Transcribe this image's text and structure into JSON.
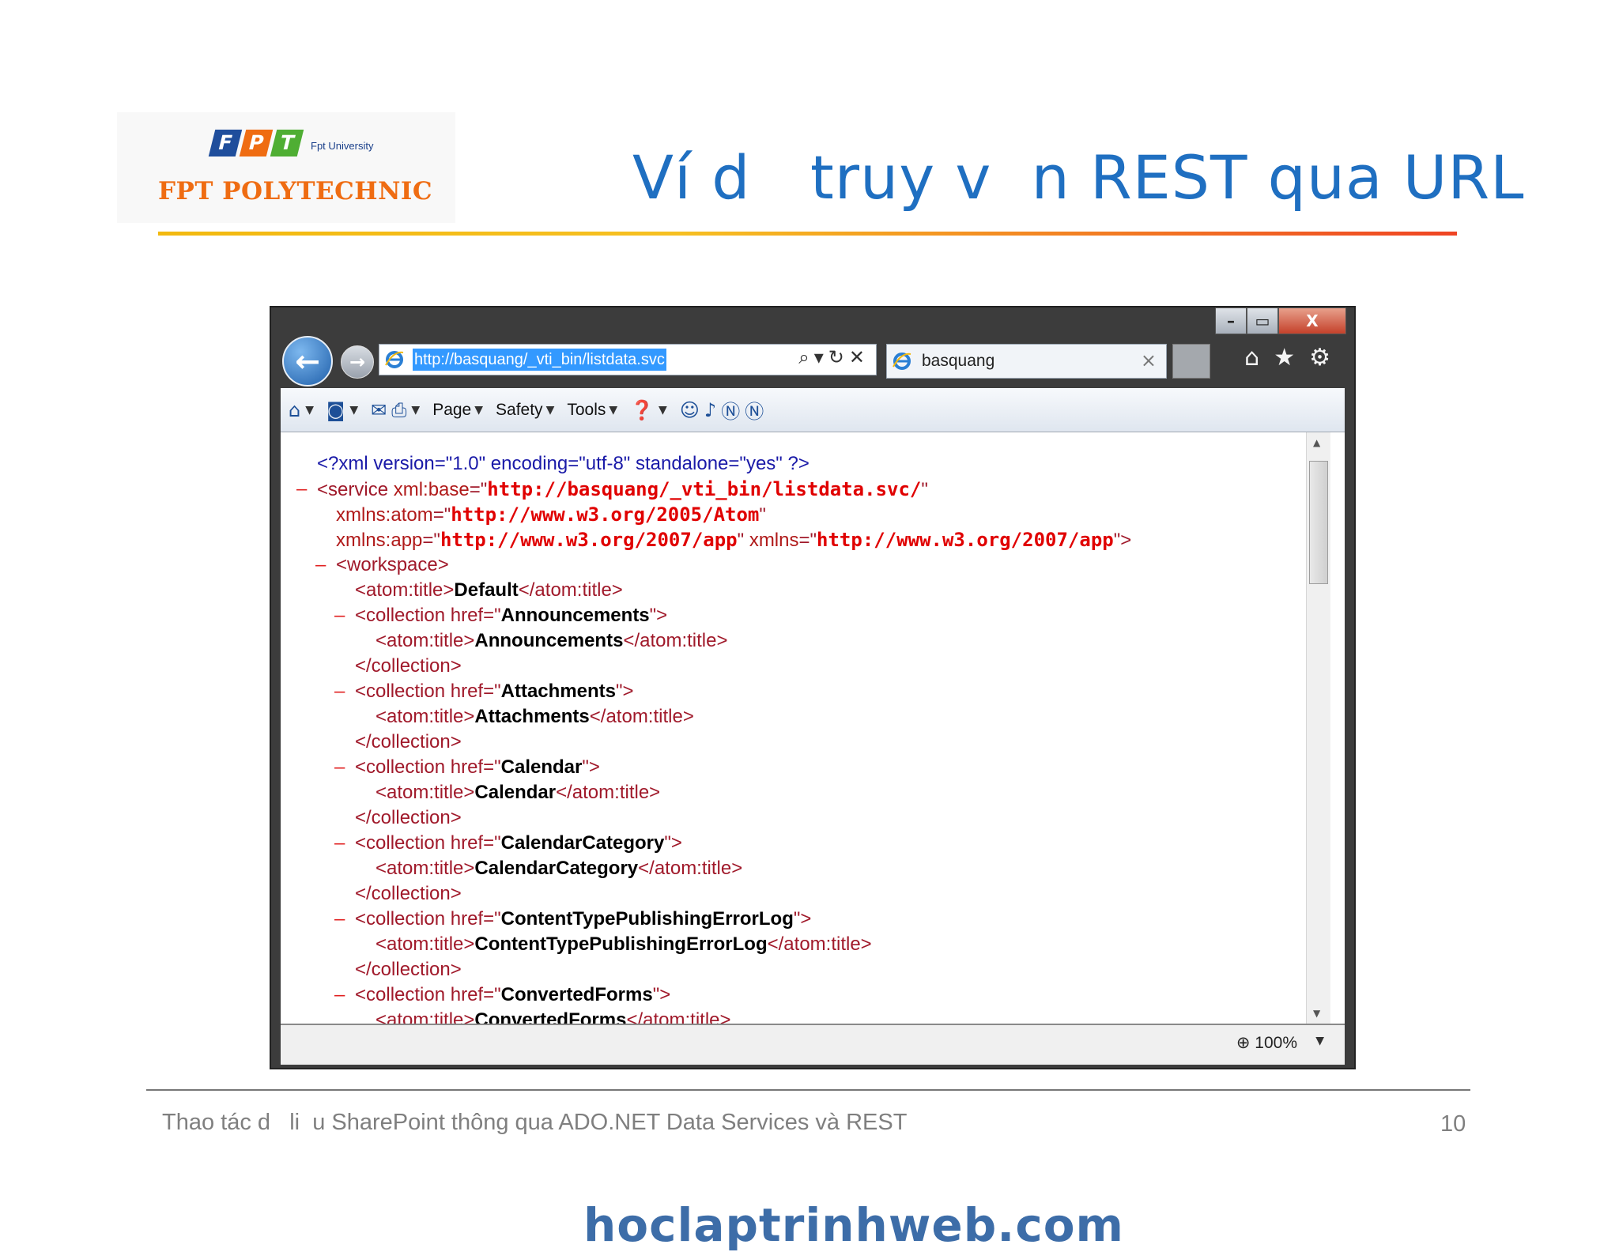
{
  "slide": {
    "title": "Ví d   truy v  n REST qua URL",
    "logo": {
      "top_letters": [
        "F",
        "P",
        "T"
      ],
      "university": "Fpt University",
      "name": "FPT POLYTECHNIC"
    },
    "footer_text": "Thao tác d   li  u SharePoint thông qua ADO.NET Data Services và REST",
    "page_number": "10",
    "watermark": "hoclaptrinhweb.com",
    "colors": {
      "title": "#1f6fc1",
      "logo_orange": "#ef6c12",
      "logo_blue": "#1f4e9c",
      "accent_rule": "#ef4424"
    }
  },
  "browser": {
    "window_buttons": [
      "–",
      "▭",
      "X"
    ],
    "address_url": "http://basquang/_vti_bin/listdata.svc",
    "address_tools": "⌕▾↻✕",
    "tab_label": "basquang",
    "toolbar_icons": [
      "home-icon",
      "star-icon",
      "gear-icon"
    ],
    "commands": {
      "page": "Page",
      "safety": "Safety",
      "tools": "Tools"
    },
    "zoom": "100%",
    "xml_lines": [
      {
        "indent": 0,
        "minus": false,
        "parts": [
          {
            "t": "pi",
            "v": "<?xml version=\"1.0\" encoding=\"utf-8\" standalone=\"yes\" ?>"
          }
        ]
      },
      {
        "indent": 0,
        "minus": true,
        "parts": [
          {
            "t": "tag",
            "v": "<service "
          },
          {
            "t": "attr",
            "v": "xml:base"
          },
          {
            "t": "tag",
            "v": "=\""
          },
          {
            "t": "val",
            "v": "http://basquang/_vti_bin/listdata.svc/"
          },
          {
            "t": "tag",
            "v": "\""
          }
        ]
      },
      {
        "indent": 1,
        "minus": false,
        "parts": [
          {
            "t": "attr",
            "v": "xmlns:atom"
          },
          {
            "t": "tag",
            "v": "=\""
          },
          {
            "t": "val",
            "v": "http://www.w3.org/2005/Atom"
          },
          {
            "t": "tag",
            "v": "\""
          }
        ]
      },
      {
        "indent": 1,
        "minus": false,
        "parts": [
          {
            "t": "attr",
            "v": "xmlns:app"
          },
          {
            "t": "tag",
            "v": "=\""
          },
          {
            "t": "val",
            "v": "http://www.w3.org/2007/app"
          },
          {
            "t": "tag",
            "v": "\" "
          },
          {
            "t": "attr",
            "v": "xmlns"
          },
          {
            "t": "tag",
            "v": "=\""
          },
          {
            "t": "val",
            "v": "http://www.w3.org/2007/app"
          },
          {
            "t": "tag",
            "v": "\">"
          }
        ]
      },
      {
        "indent": 1,
        "minus": true,
        "parts": [
          {
            "t": "tag",
            "v": "<workspace>"
          }
        ]
      },
      {
        "indent": 2,
        "minus": false,
        "parts": [
          {
            "t": "tag",
            "v": "<atom:title>"
          },
          {
            "t": "bold",
            "v": "Default"
          },
          {
            "t": "tag",
            "v": "</atom:title>"
          }
        ]
      },
      {
        "indent": 2,
        "minus": true,
        "parts": [
          {
            "t": "tag",
            "v": "<collection href=\""
          },
          {
            "t": "bold",
            "v": "Announcements"
          },
          {
            "t": "tag",
            "v": "\">"
          }
        ]
      },
      {
        "indent": 3,
        "minus": false,
        "parts": [
          {
            "t": "tag",
            "v": "<atom:title>"
          },
          {
            "t": "bold",
            "v": "Announcements"
          },
          {
            "t": "tag",
            "v": "</atom:title>"
          }
        ]
      },
      {
        "indent": 2,
        "minus": false,
        "parts": [
          {
            "t": "tag",
            "v": "</collection>"
          }
        ]
      },
      {
        "indent": 2,
        "minus": true,
        "parts": [
          {
            "t": "tag",
            "v": "<collection href=\""
          },
          {
            "t": "bold",
            "v": "Attachments"
          },
          {
            "t": "tag",
            "v": "\">"
          }
        ]
      },
      {
        "indent": 3,
        "minus": false,
        "parts": [
          {
            "t": "tag",
            "v": "<atom:title>"
          },
          {
            "t": "bold",
            "v": "Attachments"
          },
          {
            "t": "tag",
            "v": "</atom:title>"
          }
        ]
      },
      {
        "indent": 2,
        "minus": false,
        "parts": [
          {
            "t": "tag",
            "v": "</collection>"
          }
        ]
      },
      {
        "indent": 2,
        "minus": true,
        "parts": [
          {
            "t": "tag",
            "v": "<collection href=\""
          },
          {
            "t": "bold",
            "v": "Calendar"
          },
          {
            "t": "tag",
            "v": "\">"
          }
        ]
      },
      {
        "indent": 3,
        "minus": false,
        "parts": [
          {
            "t": "tag",
            "v": "<atom:title>"
          },
          {
            "t": "bold",
            "v": "Calendar"
          },
          {
            "t": "tag",
            "v": "</atom:title>"
          }
        ]
      },
      {
        "indent": 2,
        "minus": false,
        "parts": [
          {
            "t": "tag",
            "v": "</collection>"
          }
        ]
      },
      {
        "indent": 2,
        "minus": true,
        "parts": [
          {
            "t": "tag",
            "v": "<collection href=\""
          },
          {
            "t": "bold",
            "v": "CalendarCategory"
          },
          {
            "t": "tag",
            "v": "\">"
          }
        ]
      },
      {
        "indent": 3,
        "minus": false,
        "parts": [
          {
            "t": "tag",
            "v": "<atom:title>"
          },
          {
            "t": "bold",
            "v": "CalendarCategory"
          },
          {
            "t": "tag",
            "v": "</atom:title>"
          }
        ]
      },
      {
        "indent": 2,
        "minus": false,
        "parts": [
          {
            "t": "tag",
            "v": "</collection>"
          }
        ]
      },
      {
        "indent": 2,
        "minus": true,
        "parts": [
          {
            "t": "tag",
            "v": "<collection href=\""
          },
          {
            "t": "bold",
            "v": "ContentTypePublishingErrorLog"
          },
          {
            "t": "tag",
            "v": "\">"
          }
        ]
      },
      {
        "indent": 3,
        "minus": false,
        "parts": [
          {
            "t": "tag",
            "v": "<atom:title>"
          },
          {
            "t": "bold",
            "v": "ContentTypePublishingErrorLog"
          },
          {
            "t": "tag",
            "v": "</atom:title>"
          }
        ]
      },
      {
        "indent": 2,
        "minus": false,
        "parts": [
          {
            "t": "tag",
            "v": "</collection>"
          }
        ]
      },
      {
        "indent": 2,
        "minus": true,
        "parts": [
          {
            "t": "tag",
            "v": "<collection href=\""
          },
          {
            "t": "bold",
            "v": "ConvertedForms"
          },
          {
            "t": "tag",
            "v": "\">"
          }
        ]
      },
      {
        "indent": 3,
        "minus": false,
        "parts": [
          {
            "t": "tag",
            "v": "<atom:title>"
          },
          {
            "t": "bold",
            "v": "ConvertedForms"
          },
          {
            "t": "tag",
            "v": "</atom:title>"
          }
        ]
      }
    ]
  }
}
